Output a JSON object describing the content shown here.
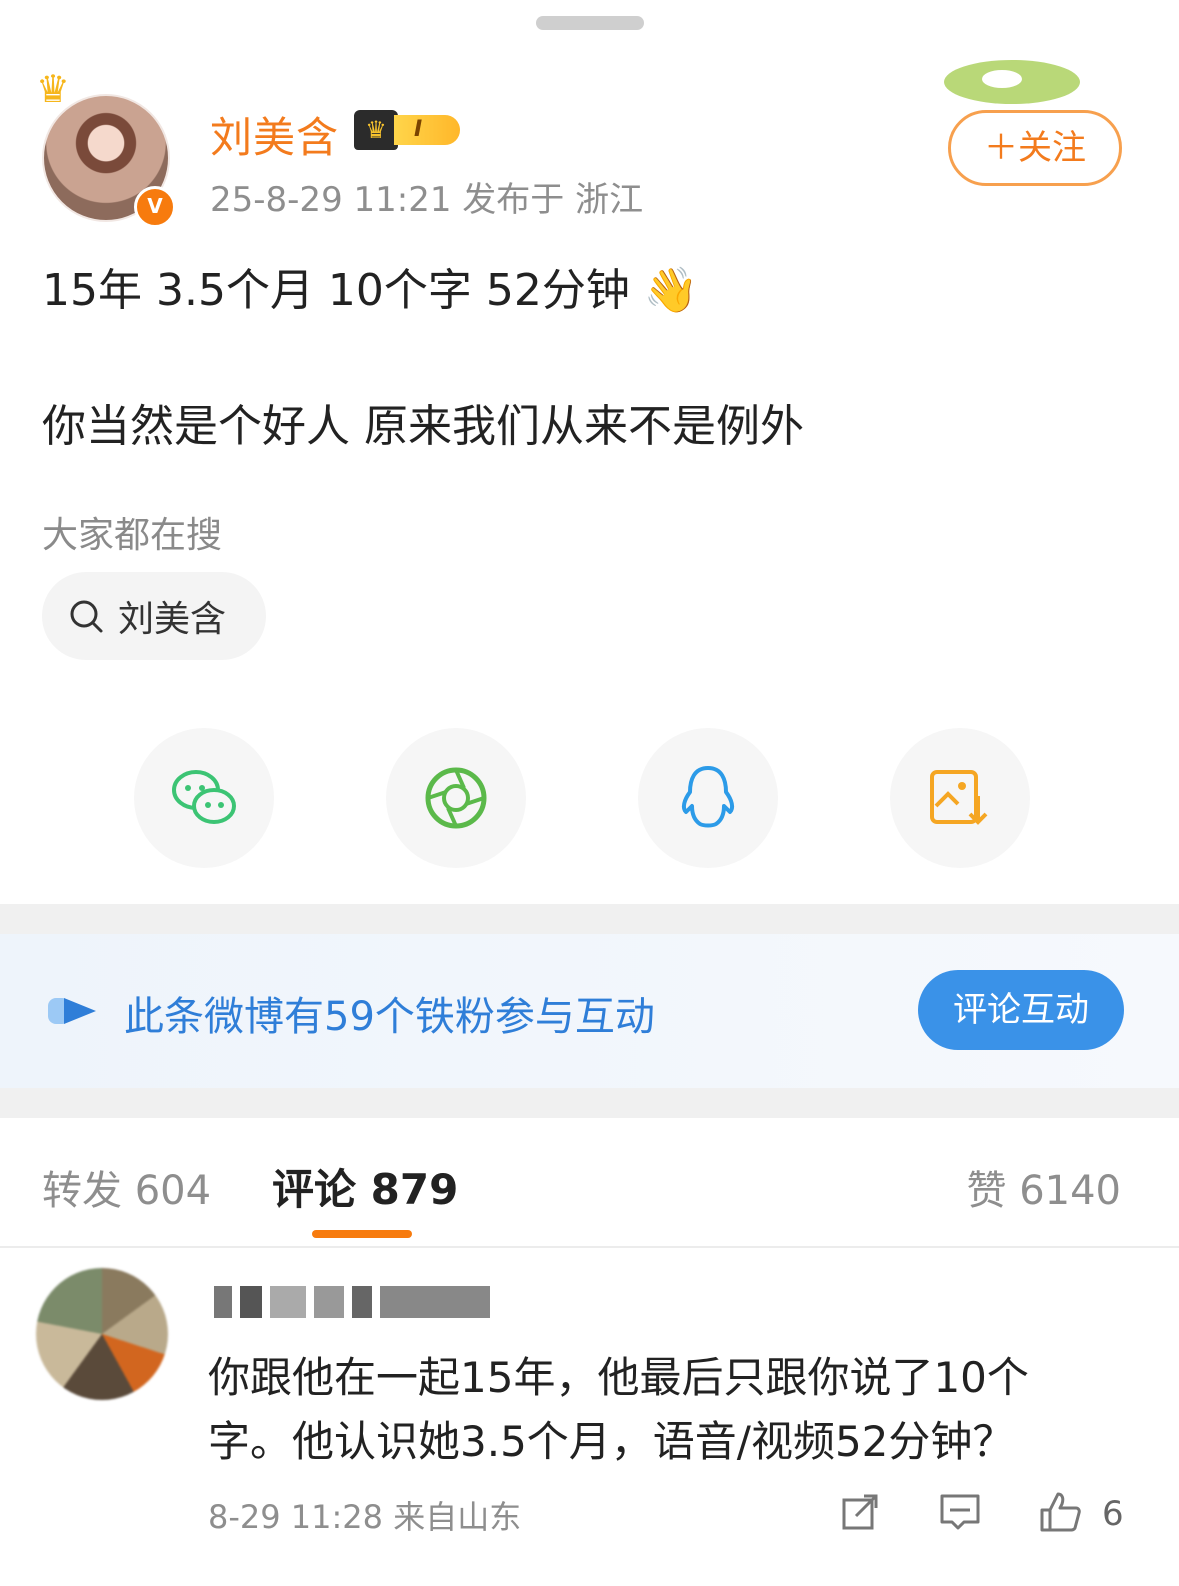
{
  "post": {
    "username": "刘美含",
    "vip_level": "I",
    "meta": "25-8-29 11:21  发布于 浙江",
    "follow_label": "＋关注",
    "line1": "15年 3.5个月 10个字 52分钟 👋",
    "line2": "你当然是个好人   原来我们从来不是例外",
    "search_hint": "大家都在搜",
    "search_chip": "刘美含"
  },
  "share_targets": [
    "wechat-icon",
    "moments-icon",
    "qq-icon",
    "save-image-icon"
  ],
  "fan_banner": {
    "text": "此条微博有59个铁粉参与互动",
    "button": "评论互动"
  },
  "tabs": {
    "repost": "转发 604",
    "comment": "评论 879",
    "like": "赞 6140"
  },
  "comment": {
    "text": "你跟他在一起15年，他最后只跟你说了10个字。他认识她3.5个月，语音/视频52分钟？",
    "meta": "8-29 11:28  来自山东",
    "like_count": "6"
  },
  "colors": {
    "accent_orange": "#f37b1d",
    "blue": "#2f7ed8",
    "button_blue": "#3a92e8"
  }
}
